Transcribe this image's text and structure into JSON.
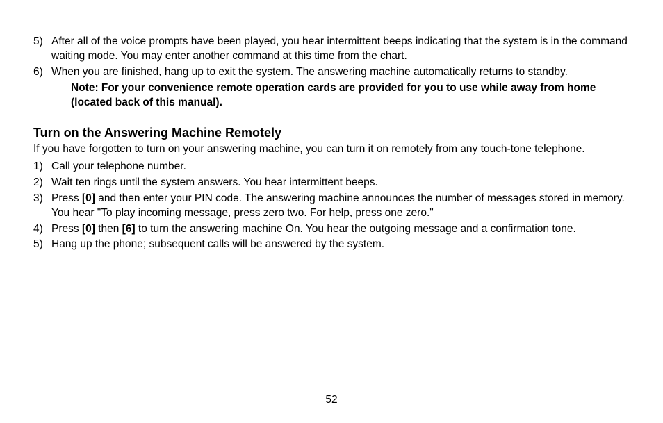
{
  "top_list": {
    "items": [
      {
        "num": "5)",
        "text": "After all of the voice prompts have been played, you hear intermittent beeps indicating that the system is in the command waiting mode. You may enter another command at this time from the chart."
      },
      {
        "num": "6)",
        "text": "When you are finished, hang up to exit the system. The answering machine automatically returns to standby."
      }
    ],
    "note": "Note: For your convenience remote operation cards are provided for you to use while away from home (located back of this manual)."
  },
  "section": {
    "heading": "Turn on the Answering Machine Remotely",
    "intro": "If you have forgotten to turn on your answering machine, you can turn it on remotely from any touch-tone telephone.",
    "items": [
      {
        "num": "1)",
        "parts": [
          {
            "t": "Call your telephone number."
          }
        ]
      },
      {
        "num": "2)",
        "parts": [
          {
            "t": "Wait ten rings until the system answers. You hear intermittent beeps."
          }
        ]
      },
      {
        "num": "3)",
        "parts": [
          {
            "t": "Press "
          },
          {
            "t": "[0]",
            "b": true
          },
          {
            "t": " and then enter your PIN code. The answering machine announces the number of messages stored in memory. You hear \"To play incoming message, press zero two. For help, press one zero.\""
          }
        ]
      },
      {
        "num": "4)",
        "parts": [
          {
            "t": "Press "
          },
          {
            "t": "[0]",
            "b": true
          },
          {
            "t": " then "
          },
          {
            "t": "[6]",
            "b": true
          },
          {
            "t": " to turn the answering machine On. You hear the outgoing message and a confirmation tone."
          }
        ]
      },
      {
        "num": "5)",
        "parts": [
          {
            "t": "Hang up the phone; subsequent calls will be answered by the system."
          }
        ]
      }
    ]
  },
  "page_number": "52"
}
